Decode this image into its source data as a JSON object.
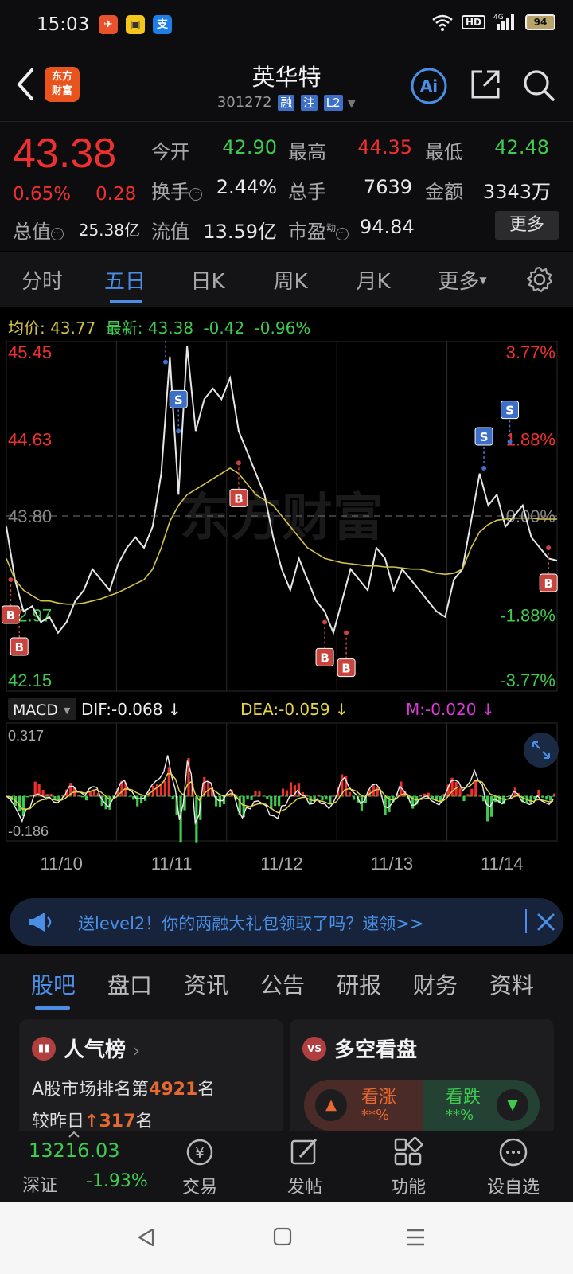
{
  "status_bar": {
    "time": "15:03",
    "network": "4G",
    "hd_label": "HD",
    "battery": "94",
    "icons": [
      "weather-app-icon",
      "news-app-icon",
      "alipay-icon",
      "wifi-icon",
      "signal-icon",
      "battery-icon"
    ]
  },
  "nav": {
    "logo_line1": "东方",
    "logo_line2": "财富",
    "title": "英华特",
    "code": "301272",
    "tags": [
      "融",
      "注",
      "L2"
    ],
    "ai_label": "Ai"
  },
  "quote": {
    "price": "43.38",
    "change_pct": "0.65%",
    "change_amt": "0.28",
    "fields": [
      {
        "label": "今开",
        "value": "42.90",
        "color": "#3fcb4f"
      },
      {
        "label": "最高",
        "value": "44.35",
        "color": "#f0302e"
      },
      {
        "label": "最低",
        "value": "42.48",
        "color": "#3fcb4f"
      },
      {
        "label": "换手",
        "value": "2.44%",
        "color": "#e8e8e8"
      },
      {
        "label": "总手",
        "value": "7639",
        "color": "#e8e8e8"
      },
      {
        "label": "金额",
        "value": "3343万",
        "color": "#e8e8e8"
      },
      {
        "label": "总值",
        "value": "25.38亿",
        "color": "#e8e8e8"
      },
      {
        "label": "流值",
        "value": "13.59亿",
        "color": "#e8e8e8"
      },
      {
        "label": "市盈",
        "value": "94.84",
        "color": "#e8e8e8"
      }
    ],
    "pe_sup": "动",
    "more_label": "更多"
  },
  "kline_tabs": [
    {
      "label": "分时",
      "active": false
    },
    {
      "label": "五日",
      "active": true
    },
    {
      "label": "日K",
      "active": false
    },
    {
      "label": "周K",
      "active": false
    },
    {
      "label": "月K",
      "active": false
    },
    {
      "label": "更多",
      "active": false
    }
  ],
  "avg_line": {
    "avg_label": "均价:",
    "avg_value": "43.77",
    "latest_label": "最新:",
    "latest_value": "43.38",
    "change": "-0.42",
    "change_pct": "-0.96%"
  },
  "macd": {
    "selector": "MACD",
    "dif": "DIF:-0.068",
    "dea": "DEA:-0.059",
    "m": "M:-0.020",
    "top_label": "0.317",
    "bottom_label": "-0.186"
  },
  "chart_data": {
    "type": "line",
    "watermark": "东方财富",
    "y_left_labels": [
      "45.45",
      "44.63",
      "43.80",
      "42.97",
      "42.15"
    ],
    "y_right_labels": [
      "3.77%",
      "1.88%",
      "0.00%",
      "-1.88%",
      "-3.77%"
    ],
    "ylim": [
      42.15,
      45.45
    ],
    "reference_price": 43.8,
    "x_labels": [
      "11/10",
      "11/11",
      "11/12",
      "11/13",
      "11/14"
    ],
    "series": [
      {
        "name": "最新",
        "color": "#e6e6e6",
        "values": [
          43.7,
          43.2,
          42.9,
          42.95,
          42.8,
          42.85,
          42.7,
          42.8,
          43.0,
          43.1,
          43.3,
          43.2,
          43.1,
          43.35,
          43.5,
          43.6,
          43.5,
          43.7,
          44.2,
          45.3,
          44.0,
          45.4,
          44.6,
          44.9,
          45.0,
          44.9,
          45.1,
          44.6,
          44.4,
          44.2,
          44.0,
          43.6,
          43.3,
          43.1,
          43.4,
          43.2,
          43.0,
          42.9,
          42.7,
          43.0,
          43.3,
          43.2,
          43.1,
          43.5,
          43.4,
          43.1,
          43.3,
          43.2,
          43.1,
          43.0,
          42.9,
          42.85,
          43.2,
          43.3,
          43.75,
          44.2,
          43.9,
          44.0,
          43.7,
          43.8,
          43.9,
          43.6,
          43.5,
          43.4,
          43.38
        ],
        "x": [
          0,
          2,
          4,
          6,
          8,
          10,
          12,
          14,
          16,
          18,
          20,
          22,
          24,
          26,
          28,
          30,
          32,
          34,
          36,
          38,
          40,
          42,
          44,
          46,
          48,
          50,
          52,
          54,
          56,
          58,
          60,
          62,
          64,
          66,
          68,
          70,
          72,
          74,
          76,
          78,
          80,
          82,
          84,
          86,
          88,
          90,
          92,
          94,
          96,
          98,
          100,
          102,
          104,
          106,
          108,
          110,
          112,
          114,
          116,
          118,
          120,
          122,
          124,
          126,
          128
        ]
      },
      {
        "name": "均价",
        "color": "#d4c24a",
        "values": [
          43.4,
          43.2,
          43.1,
          43.05,
          43.0,
          43.0,
          42.98,
          42.97,
          42.97,
          42.98,
          43.0,
          43.02,
          43.05,
          43.08,
          43.12,
          43.16,
          43.2,
          43.3,
          43.5,
          43.75,
          43.9,
          44.0,
          44.05,
          44.1,
          44.15,
          44.2,
          44.25,
          44.2,
          44.1,
          44.0,
          43.95,
          43.9,
          43.8,
          43.7,
          43.6,
          43.5,
          43.45,
          43.4,
          43.38,
          43.36,
          43.35,
          43.34,
          43.33,
          43.33,
          43.32,
          43.32,
          43.31,
          43.3,
          43.3,
          43.28,
          43.26,
          43.25,
          43.26,
          43.3,
          43.5,
          43.65,
          43.72,
          43.76,
          43.77,
          43.78,
          43.78,
          43.78,
          43.77,
          43.77,
          43.77
        ],
        "x": [
          0,
          2,
          4,
          6,
          8,
          10,
          12,
          14,
          16,
          18,
          20,
          22,
          24,
          26,
          28,
          30,
          32,
          34,
          36,
          38,
          40,
          42,
          44,
          46,
          48,
          50,
          52,
          54,
          56,
          58,
          60,
          62,
          64,
          66,
          68,
          70,
          72,
          74,
          76,
          78,
          80,
          82,
          84,
          86,
          88,
          90,
          92,
          94,
          96,
          98,
          100,
          102,
          104,
          106,
          108,
          110,
          112,
          114,
          116,
          118,
          120,
          122,
          124,
          126,
          128
        ]
      }
    ],
    "markers": [
      {
        "label": "B",
        "x": 1,
        "price": 43.2
      },
      {
        "label": "B",
        "x": 3,
        "price": 42.9
      },
      {
        "label": "S",
        "x": 37,
        "price": 45.25
      },
      {
        "label": "S",
        "x": 40,
        "price": 44.6
      },
      {
        "label": "B",
        "x": 54,
        "price": 44.3
      },
      {
        "label": "B",
        "x": 74,
        "price": 42.8
      },
      {
        "label": "B",
        "x": 79,
        "price": 42.7
      },
      {
        "label": "S",
        "x": 111,
        "price": 44.25
      },
      {
        "label": "S",
        "x": 117,
        "price": 44.5
      },
      {
        "label": "B",
        "x": 126,
        "price": 43.5
      }
    ]
  },
  "banner": {
    "text": "送level2！你的两融大礼包领取了吗？速领>>"
  },
  "bottom_tabs": [
    {
      "label": "股吧",
      "active": true
    },
    {
      "label": "盘口",
      "active": false
    },
    {
      "label": "资讯",
      "active": false
    },
    {
      "label": "公告",
      "active": false
    },
    {
      "label": "研报",
      "active": false
    },
    {
      "label": "财务",
      "active": false
    },
    {
      "label": "资料",
      "active": false
    }
  ],
  "popularity_card": {
    "title": "人气榜",
    "line1_pre": "A股市场排名第",
    "line1_num": "4921",
    "line1_post": "名",
    "line2_pre": "较昨日",
    "line2_num": "317",
    "line2_post": "名"
  },
  "vs_card": {
    "title": "多空看盘",
    "up_label": "看涨",
    "up_value": "**%",
    "down_label": "看跌",
    "down_value": "**%"
  },
  "bottom_bar": {
    "index_value": "13216.03",
    "index_name": "深证",
    "index_pct": "-1.93%",
    "items": [
      {
        "label": "交易"
      },
      {
        "label": "发帖"
      },
      {
        "label": "功能"
      },
      {
        "label": "设自选"
      }
    ]
  }
}
